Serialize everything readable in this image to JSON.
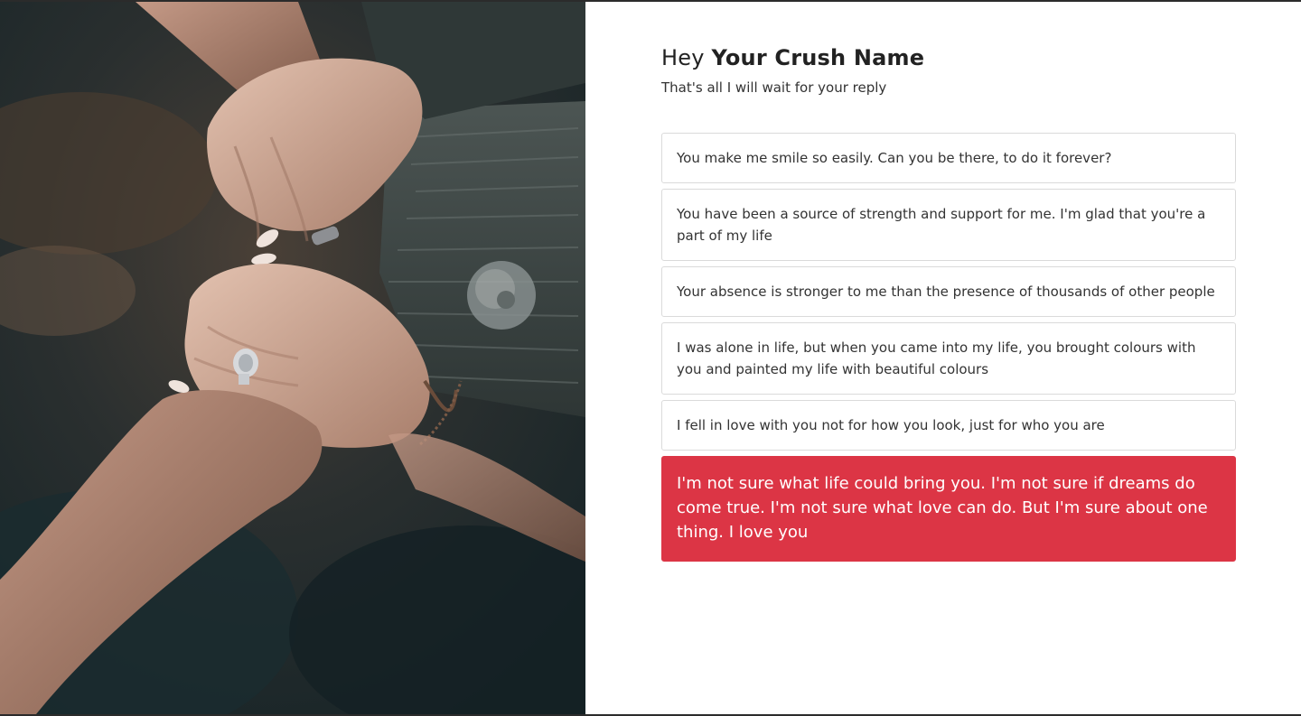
{
  "header": {
    "greeting_prefix": "Hey",
    "crush_name": "Your Crush Name",
    "subtitle": "That's all I will wait for your reply"
  },
  "messages": [
    {
      "text": "You make me smile so easily. Can you be there, to do it forever?"
    },
    {
      "text": "You have been a source of strength and support for me. I'm glad that you're a part of my life"
    },
    {
      "text": "Your absence is stronger to me than the presence of thousands of other people"
    },
    {
      "text": "I was alone in life, but when you came into my life, you brought colours with you and painted my life with beautiful colours"
    },
    {
      "text": "I fell in love with you not for how you look, just for who you are"
    },
    {
      "text": "I'm not sure what life could bring you. I'm not sure if dreams do come true. I'm not sure what love can do. But I'm sure about one thing. I love you"
    }
  ],
  "colors": {
    "active_message_bg": "#dc3545",
    "message_border": "#dadada"
  }
}
